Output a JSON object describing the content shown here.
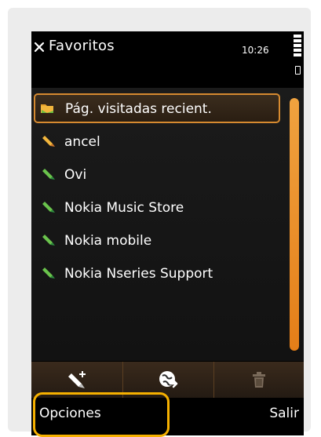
{
  "header": {
    "title": "Favoritos",
    "time": "10:26",
    "close_icon": "close-icon",
    "signal_icon": "signal-bars-icon",
    "battery_icon": "battery-icon"
  },
  "list": {
    "items": [
      {
        "label": "Pág. visitadas recient.",
        "icon": "folder-icon",
        "selected": true
      },
      {
        "label": "ancel",
        "icon": "bookmark-icon",
        "selected": false
      },
      {
        "label": "Ovi",
        "icon": "bookmark-icon",
        "selected": false
      },
      {
        "label": "Nokia Music Store",
        "icon": "bookmark-icon",
        "selected": false
      },
      {
        "label": "Nokia mobile",
        "icon": "bookmark-icon",
        "selected": false
      },
      {
        "label": "Nokia Nseries Support",
        "icon": "bookmark-icon",
        "selected": false
      }
    ]
  },
  "toolbar": {
    "buttons": [
      {
        "icon": "add-bookmark-icon"
      },
      {
        "icon": "web-go-icon"
      },
      {
        "icon": "trash-icon"
      }
    ]
  },
  "softkeys": {
    "left_label": "Opciones",
    "right_label": "Salir"
  },
  "colors": {
    "accent": "#e68a2a",
    "highlight": "#f5b000",
    "toolbar": "#2f2217"
  }
}
